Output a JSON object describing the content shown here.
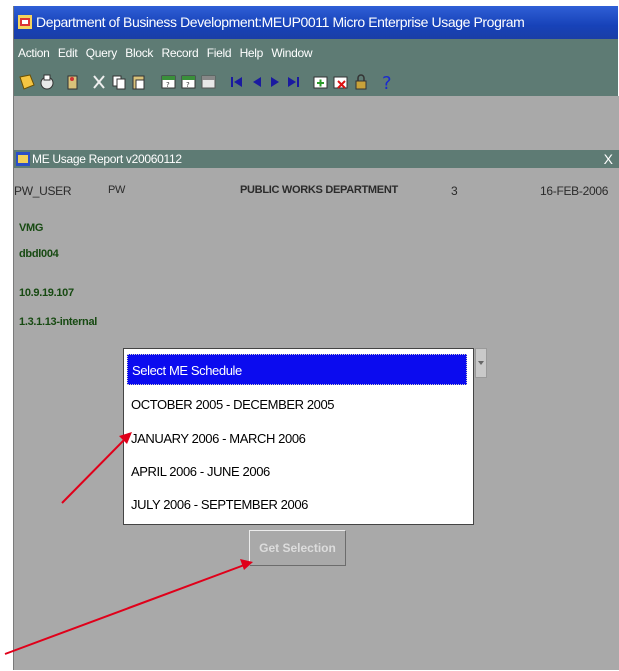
{
  "window": {
    "title": "Department of Business Development:MEUP0011 Micro Enterprise Usage Program"
  },
  "menu": {
    "items": [
      "Action",
      "Edit",
      "Query",
      "Block",
      "Record",
      "Field",
      "Help",
      "Window"
    ]
  },
  "toolbar": {
    "icons": [
      "save-icon",
      "print-icon",
      "exit-icon",
      "cut-icon",
      "copy-icon",
      "paste-icon",
      "enter-query-icon",
      "execute-query-icon",
      "cancel-query-icon",
      "first-record-icon",
      "previous-record-icon",
      "next-record-icon",
      "last-record-icon",
      "insert-record-icon",
      "delete-record-icon",
      "lock-record-icon",
      "help-icon"
    ]
  },
  "report": {
    "title": "ME Usage Report v20060112",
    "close": "X",
    "user_field": "PW_USER",
    "dept_code": "PW",
    "dept_name": "PUBLIC WORKS DEPARTMENT",
    "count": "3",
    "date": "16-FEB-2006",
    "info_lines": [
      "VMG",
      "dbdl004",
      "10.9.19.107",
      "1.3.1.13-internal"
    ]
  },
  "schedule_select": {
    "selected": "Select ME Schedule",
    "options": [
      "OCTOBER 2005 - DECEMBER 2005",
      "JANUARY  2006 - MARCH 2006",
      "APRIL 2006 - JUNE 2006",
      "JULY 2006 - SEPTEMBER 2006"
    ]
  },
  "get_selection_button": {
    "label": "Get Selection"
  },
  "colors": {
    "title_bar": "#1742b8",
    "menu_bar": "#5e7b74",
    "window_bg": "#a9a9a9",
    "selection": "#0b0bef",
    "info_text": "#174a12",
    "annotation_arrow": "#e0001a"
  }
}
